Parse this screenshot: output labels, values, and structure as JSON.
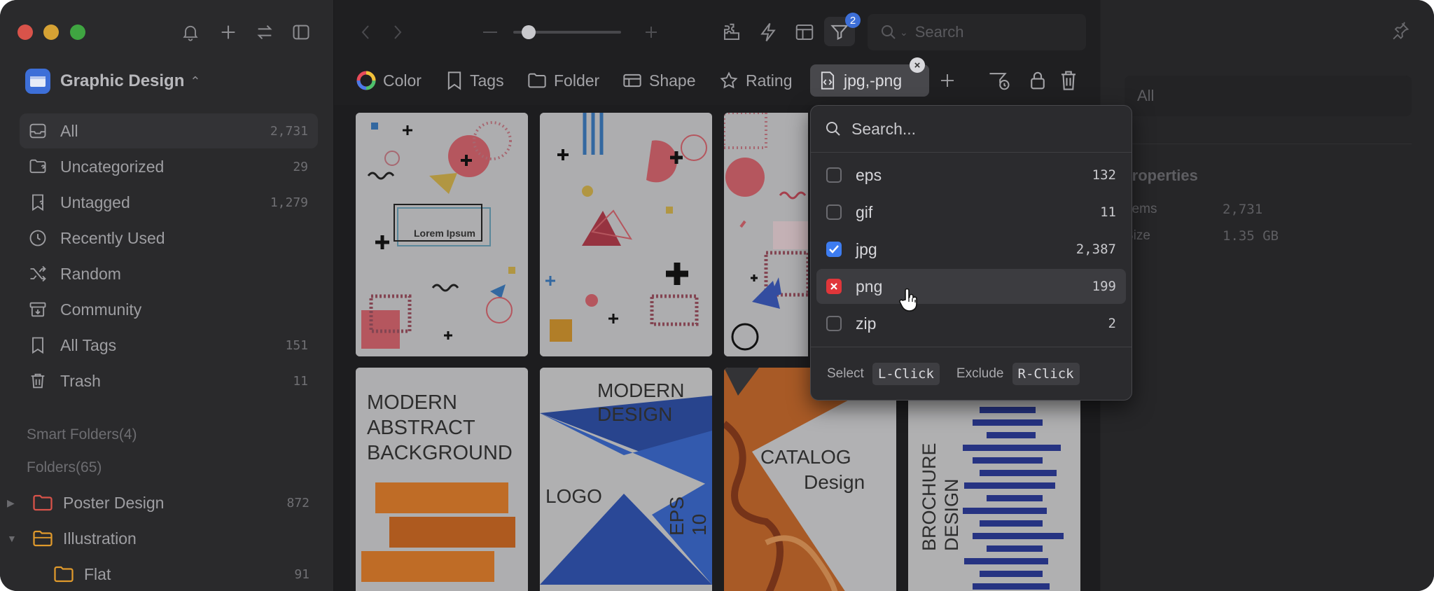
{
  "library": {
    "name": "Graphic Design"
  },
  "nav": [
    {
      "label": "All",
      "count": "2,731",
      "icon": "inbox-icon"
    },
    {
      "label": "Uncategorized",
      "count": "29",
      "icon": "folder-question-icon"
    },
    {
      "label": "Untagged",
      "count": "1,279",
      "icon": "tag-question-icon"
    },
    {
      "label": "Recently Used",
      "count": "",
      "icon": "clock-icon"
    },
    {
      "label": "Random",
      "count": "",
      "icon": "shuffle-icon"
    },
    {
      "label": "Community",
      "count": "",
      "icon": "archive-icon"
    },
    {
      "label": "All Tags",
      "count": "151",
      "icon": "bookmark-icon"
    },
    {
      "label": "Trash",
      "count": "11",
      "icon": "trash-icon"
    }
  ],
  "sections": {
    "smart_folders": "Smart Folders(4)",
    "folders": "Folders(65)"
  },
  "folders": [
    {
      "label": "Poster Design",
      "count": "872",
      "color": "#d9534a"
    },
    {
      "label": "Illustration",
      "count": "",
      "color": "#e09a2c"
    },
    {
      "label": "Flat",
      "count": "91",
      "color": "#e09a2c"
    }
  ],
  "toolbar": {
    "search_placeholder": "Search",
    "filter_badge": "2"
  },
  "filters": {
    "color": "Color",
    "tags": "Tags",
    "folder": "Folder",
    "shape": "Shape",
    "rating": "Rating",
    "active": "jpg,-png"
  },
  "cards": {
    "c1": "Lorem Ipsum",
    "c4a": "MODERN",
    "c4b": "ABSTRACT",
    "c4c": "BACKGROUND",
    "c5a": "MODERN",
    "c5b": "DESIGN",
    "c5c": "LOGO",
    "c5d": "EPS 10",
    "c6a": "CATALOG",
    "c6b": "Design",
    "c7a": "BROCHURE",
    "c7b": "DESIGN"
  },
  "dropdown": {
    "search_placeholder": "Search...",
    "items": [
      {
        "label": "eps",
        "count": "132",
        "state": "none"
      },
      {
        "label": "gif",
        "count": "11",
        "state": "none"
      },
      {
        "label": "jpg",
        "count": "2,387",
        "state": "checked"
      },
      {
        "label": "png",
        "count": "199",
        "state": "excluded"
      },
      {
        "label": "zip",
        "count": "2",
        "state": "none"
      }
    ],
    "footer": {
      "select_label": "Select",
      "select_key": "L-Click",
      "exclude_label": "Exclude",
      "exclude_key": "R-Click"
    }
  },
  "inspector": {
    "all_field": "All",
    "properties": "Properties",
    "rows": [
      {
        "label": "Items",
        "value": "2,731"
      },
      {
        "label": "Size",
        "value": "1.35 GB"
      }
    ]
  }
}
